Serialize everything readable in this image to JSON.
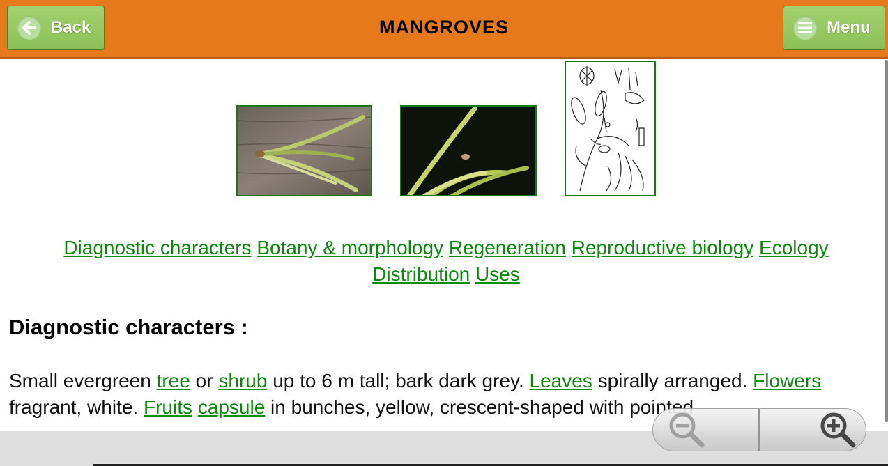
{
  "header": {
    "title": "MANGROVES",
    "back_label": "Back",
    "menu_label": "Menu",
    "bar_color": "#e5791b",
    "button_color": "#8cc057"
  },
  "gallery": [
    {
      "name": "leaf-photo-wood-background"
    },
    {
      "name": "leaf-photo-dark-background"
    },
    {
      "name": "botanical-line-drawing"
    }
  ],
  "section_links": [
    "Diagnostic characters",
    "Botany & morphology",
    "Regeneration",
    "Reproductive biology",
    "Ecology",
    "Distribution",
    "Uses"
  ],
  "content": {
    "heading": "Diagnostic characters :",
    "p1": "Small evergreen ",
    "l1": "tree",
    "p2": " or ",
    "l2": "shrub",
    "p3": " up to 6 m tall; bark dark grey. ",
    "l3": "Leaves",
    "p4": " spirally arranged. ",
    "l4": "Flowers",
    "p5": " fragrant, white. ",
    "l5": "Fruits",
    "p6": " ",
    "l6": "capsule",
    "p7": " in bunches, yellow, crescent-shaped with pointed"
  },
  "zoom_controls": {
    "zoom_out_icon": "zoom-out-icon",
    "zoom_in_icon": "zoom-in-icon"
  },
  "link_color": "#0a8a0a"
}
